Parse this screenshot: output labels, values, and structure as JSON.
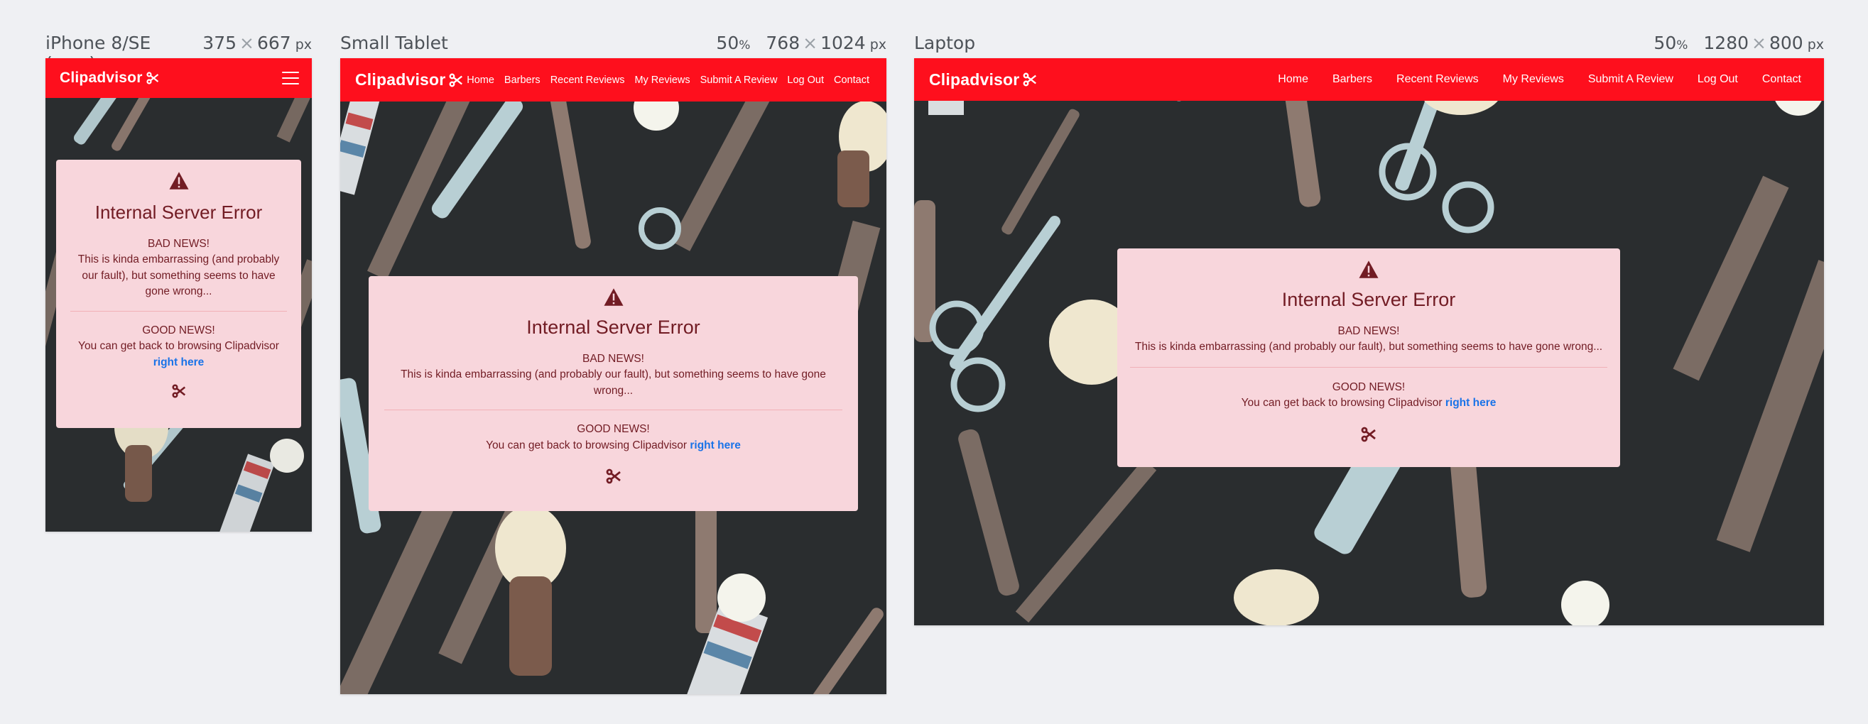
{
  "devices": [
    {
      "id": "phone",
      "title": "iPhone 8/SE (new)",
      "zoom": "",
      "width": "375",
      "height": "667",
      "unit": "px"
    },
    {
      "id": "tablet",
      "title": "Small Tablet",
      "zoom": "50",
      "zoom_unit": "%",
      "width": "768",
      "height": "1024",
      "unit": "px"
    },
    {
      "id": "laptop",
      "title": "Laptop",
      "zoom": "50",
      "zoom_unit": "%",
      "width": "1280",
      "height": "800",
      "unit": "px"
    }
  ],
  "dims_separator": "×",
  "site": {
    "brand": "Clipadvisor",
    "nav": [
      "Home",
      "Barbers",
      "Recent Reviews",
      "My Reviews",
      "Submit A Review",
      "Log Out",
      "Contact"
    ]
  },
  "error": {
    "title": "Internal Server Error",
    "bad_heading": "BAD NEWS!",
    "bad_text": "This is kinda embarrassing (and probably our fault), but something seems to have gone wrong...",
    "good_heading": "GOOD NEWS!",
    "good_text": "You can get back to browsing Clipadvisor",
    "link_text": "right here"
  },
  "colors": {
    "navbar": "#fe0f1d",
    "card_bg": "#f8d6dc",
    "card_text": "#721c24",
    "link": "#1a73e8",
    "page_bg": "#eff0f3",
    "frame_bg": "#2a2d2f"
  },
  "icons": [
    "warning-icon",
    "scissors-icon",
    "hamburger-menu-icon"
  ]
}
